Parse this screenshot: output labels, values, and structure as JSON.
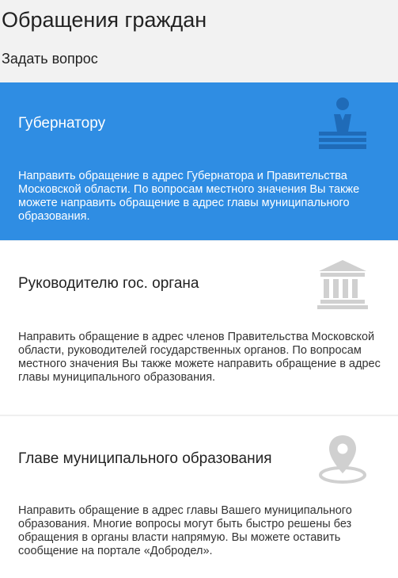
{
  "header": {
    "title": "Обращения граждан",
    "subtitle": "Задать вопрос"
  },
  "cards": [
    {
      "title": "Губернатору",
      "description": "Направить обращение в адрес Губернатора и Правительства Московской области. По вопросам местного значения Вы также можете направить обращение в адрес главы муниципального образования.",
      "icon": "podium-speaker-icon",
      "active": true
    },
    {
      "title": "Руководителю гос. органа",
      "description": "Направить обращение в адрес членов Правительства Московской области, руководителей государственных органов. По вопросам местного значения Вы также можете направить обращение в адрес главы муниципального образования.",
      "icon": "government-building-icon",
      "active": false
    },
    {
      "title": "Главе муниципального образования",
      "description": "Направить обращение в адрес главы Вашего муниципального образования. Многие вопросы могут быть быстро решены без обращения в органы власти напрямую. Вы можете оставить сообщение на портале «Добродел».",
      "icon": "map-pin-icon",
      "active": false
    }
  ],
  "colors": {
    "accent": "#2f8de3",
    "background": "#f2f2f2",
    "card": "#ffffff",
    "text": "#222222",
    "icon_on_accent": "#1f6bb8",
    "icon_muted": "#d0d0d0"
  }
}
